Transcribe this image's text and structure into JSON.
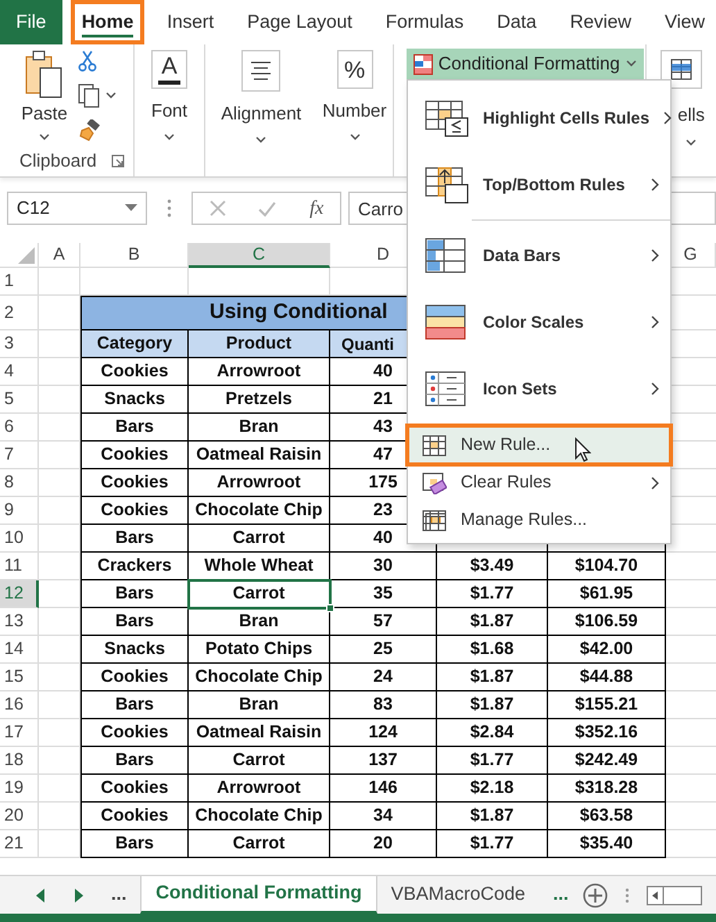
{
  "tabs": [
    {
      "label": "File",
      "kind": "file",
      "selected": false,
      "annotated": false
    },
    {
      "label": "Home",
      "kind": "tab",
      "selected": true,
      "annotated": true
    },
    {
      "label": "Insert",
      "kind": "tab",
      "selected": false,
      "annotated": false
    },
    {
      "label": "Page Layout",
      "kind": "tab",
      "selected": false,
      "annotated": false
    },
    {
      "label": "Formulas",
      "kind": "tab",
      "selected": false,
      "annotated": false
    },
    {
      "label": "Data",
      "kind": "tab",
      "selected": false,
      "annotated": false
    },
    {
      "label": "Review",
      "kind": "tab",
      "selected": false,
      "annotated": false
    },
    {
      "label": "View",
      "kind": "tab",
      "selected": false,
      "annotated": false
    }
  ],
  "ribbon": {
    "groups": [
      {
        "kind": "clipboard",
        "label": "Paste",
        "group_label": "Clipboard"
      },
      {
        "kind": "font",
        "label": "Font",
        "glyph": "A"
      },
      {
        "kind": "alignment",
        "label": "Alignment"
      },
      {
        "kind": "number",
        "label": "Number",
        "glyph": "%"
      },
      {
        "kind": "styles",
        "label": "Conditional Formatting",
        "expanded": true
      },
      {
        "kind": "cells",
        "label": "ells"
      }
    ]
  },
  "formula_bar": {
    "name_box": "C12",
    "function_label": "fx",
    "formula": "Carro"
  },
  "columns": [
    {
      "label": "A",
      "selected": false
    },
    {
      "label": "B",
      "selected": false
    },
    {
      "label": "C",
      "selected": true
    },
    {
      "label": "D",
      "selected": false
    },
    {
      "label": "G",
      "selected": false
    }
  ],
  "rows": [
    {
      "number": "1",
      "kind": "blank",
      "selected": false
    },
    {
      "number": "2",
      "kind": "title",
      "selected": false,
      "title": "Using Conditional"
    },
    {
      "number": "3",
      "kind": "header",
      "selected": false,
      "cells": [
        "Category",
        "Product",
        "Quanti"
      ]
    },
    {
      "number": "4",
      "kind": "data",
      "selected": false,
      "cells": [
        "Cookies",
        "Arrowroot",
        "40"
      ]
    },
    {
      "number": "5",
      "kind": "data",
      "selected": false,
      "cells": [
        "Snacks",
        "Pretzels",
        "21"
      ]
    },
    {
      "number": "6",
      "kind": "data",
      "selected": false,
      "cells": [
        "Bars",
        "Bran",
        "43"
      ]
    },
    {
      "number": "7",
      "kind": "data",
      "selected": false,
      "cells": [
        "Cookies",
        "Oatmeal Raisin",
        "47"
      ]
    },
    {
      "number": "8",
      "kind": "data",
      "selected": false,
      "cells": [
        "Cookies",
        "Arrowroot",
        "175"
      ]
    },
    {
      "number": "9",
      "kind": "data",
      "selected": false,
      "cells": [
        "Cookies",
        "Chocolate Chip",
        "23"
      ]
    },
    {
      "number": "10",
      "kind": "data",
      "selected": false,
      "cells": [
        "Bars",
        "Carrot",
        "40"
      ]
    },
    {
      "number": "11",
      "kind": "data",
      "selected": false,
      "cells": [
        "Crackers",
        "Whole Wheat",
        "30",
        "$3.49",
        "$104.70"
      ]
    },
    {
      "number": "12",
      "kind": "data",
      "selected": true,
      "cells": [
        "Bars",
        "Carrot",
        "35",
        "$1.77",
        "$61.95"
      ]
    },
    {
      "number": "13",
      "kind": "data",
      "selected": false,
      "cells": [
        "Bars",
        "Bran",
        "57",
        "$1.87",
        "$106.59"
      ]
    },
    {
      "number": "14",
      "kind": "data",
      "selected": false,
      "cells": [
        "Snacks",
        "Potato Chips",
        "25",
        "$1.68",
        "$42.00"
      ]
    },
    {
      "number": "15",
      "kind": "data",
      "selected": false,
      "cells": [
        "Cookies",
        "Chocolate Chip",
        "24",
        "$1.87",
        "$44.88"
      ]
    },
    {
      "number": "16",
      "kind": "data",
      "selected": false,
      "cells": [
        "Bars",
        "Bran",
        "83",
        "$1.87",
        "$155.21"
      ]
    },
    {
      "number": "17",
      "kind": "data",
      "selected": false,
      "cells": [
        "Cookies",
        "Oatmeal Raisin",
        "124",
        "$2.84",
        "$352.16"
      ]
    },
    {
      "number": "18",
      "kind": "data",
      "selected": false,
      "cells": [
        "Bars",
        "Carrot",
        "137",
        "$1.77",
        "$242.49"
      ]
    },
    {
      "number": "19",
      "kind": "data",
      "selected": false,
      "cells": [
        "Cookies",
        "Arrowroot",
        "146",
        "$2.18",
        "$318.28"
      ]
    },
    {
      "number": "20",
      "kind": "data",
      "selected": false,
      "cells": [
        "Cookies",
        "Chocolate Chip",
        "34",
        "$1.87",
        "$63.58"
      ]
    },
    {
      "number": "21",
      "kind": "data",
      "selected": false,
      "cells": [
        "Bars",
        "Carrot",
        "20",
        "$1.77",
        "$35.40"
      ]
    }
  ],
  "menu": {
    "items": [
      {
        "label": "Highlight Cells Rules",
        "kind": "highlight",
        "submenu": true,
        "selected": false,
        "annotated": false
      },
      {
        "label": "Top/Bottom Rules",
        "kind": "topbottom",
        "submenu": true,
        "selected": false,
        "annotated": false
      },
      {
        "label": "Data Bars",
        "kind": "databars",
        "submenu": true,
        "selected": false,
        "annotated": false
      },
      {
        "label": "Color Scales",
        "kind": "colorscales",
        "submenu": true,
        "selected": false,
        "annotated": false
      },
      {
        "label": "Icon Sets",
        "kind": "iconsets",
        "submenu": true,
        "selected": false,
        "annotated": false
      },
      {
        "label": "New Rule...",
        "kind": "newrule",
        "submenu": false,
        "selected": true,
        "annotated": true
      },
      {
        "label": "Clear Rules",
        "kind": "clear",
        "submenu": true,
        "selected": false,
        "annotated": false
      },
      {
        "label": "Manage Rules...",
        "kind": "manage",
        "submenu": false,
        "selected": false,
        "annotated": false
      }
    ]
  },
  "sheet_bar": {
    "more_left": "...",
    "tabs": [
      {
        "label": "Conditional Formatting",
        "selected": true
      },
      {
        "label": "VBAMacroCode",
        "selected": false
      }
    ],
    "more_right": "..."
  }
}
